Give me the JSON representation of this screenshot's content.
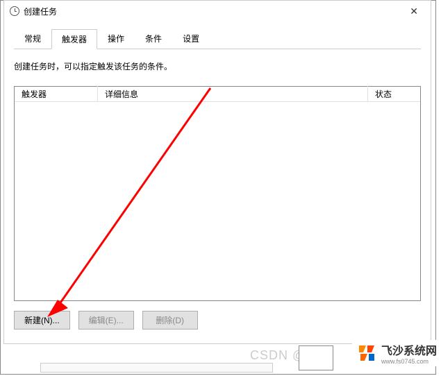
{
  "window": {
    "title": "创建任务",
    "close": "✕"
  },
  "tabs": [
    {
      "label": "常规",
      "active": false
    },
    {
      "label": "触发器",
      "active": true
    },
    {
      "label": "操作",
      "active": false
    },
    {
      "label": "条件",
      "active": false
    },
    {
      "label": "设置",
      "active": false
    }
  ],
  "description": "创建任务时，可以指定触发该任务的条件。",
  "table": {
    "headers": {
      "col1": "触发器",
      "col2": "详细信息",
      "col3": "状态"
    },
    "rows": []
  },
  "buttons": {
    "new": "新建(N)...",
    "edit": "编辑(E)...",
    "delete": "删除(D)"
  },
  "watermark": "CSDN @",
  "brand": {
    "name": "飞沙系统网",
    "url": "www.fs0745.com"
  }
}
